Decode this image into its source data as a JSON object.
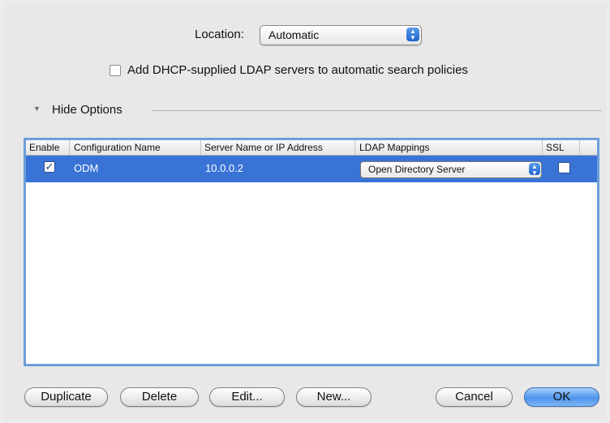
{
  "location": {
    "label": "Location:",
    "value": "Automatic"
  },
  "dhcp": {
    "label": "Add DHCP-supplied LDAP servers to automatic search policies",
    "checked": false
  },
  "options": {
    "disclosure_label": "Hide Options",
    "expanded": true
  },
  "table": {
    "columns": [
      "Enable",
      "Configuration Name",
      "Server Name or IP Address",
      "LDAP Mappings",
      "SSL"
    ],
    "rows": [
      {
        "enabled": true,
        "enabled_glyph": "✓",
        "config_name": "ODM",
        "server": "10.0.0.2",
        "mapping": "Open Directory Server",
        "ssl": false
      }
    ]
  },
  "buttons": {
    "duplicate": "Duplicate",
    "delete": "Delete",
    "edit": "Edit...",
    "new": "New...",
    "cancel": "Cancel",
    "ok": "OK"
  },
  "colors": {
    "selection": "#3a73d6",
    "focus_ring": "#6c9fd8",
    "default_button": "#4e93ec"
  },
  "icons": {
    "popup_arrows": "updown-arrows-icon",
    "disclosure": "disclosure-triangle-down-icon"
  }
}
